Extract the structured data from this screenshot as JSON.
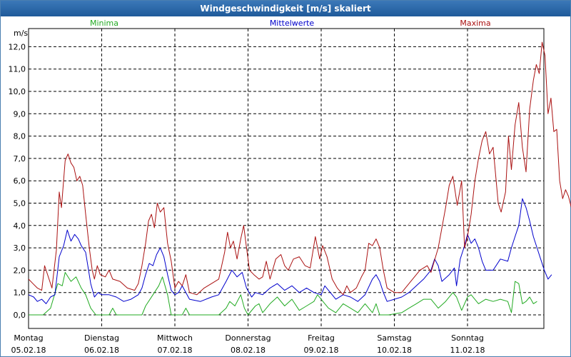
{
  "window": {
    "title": "Windgeschwindigkeit [m/s] skaliert"
  },
  "chart_data": {
    "type": "line",
    "title": "Windgeschwindigkeit [m/s] skaliert",
    "ylabel": "m/s",
    "ylim": [
      -0.8,
      12.6
    ],
    "yticks": [
      "0,0",
      "1,0",
      "2,0",
      "3,0",
      "4,0",
      "5,0",
      "6,0",
      "7,0",
      "8,0",
      "9,0",
      "10,0",
      "11,0",
      "12,0"
    ],
    "xlim": [
      0,
      7
    ],
    "days": [
      {
        "name": "Montag",
        "date": "05.02.18"
      },
      {
        "name": "Dienstag",
        "date": "06.02.18"
      },
      {
        "name": "Mittwoch",
        "date": "07.02.18"
      },
      {
        "name": "Donnerstag",
        "date": "08.02.18"
      },
      {
        "name": "Freitag",
        "date": "09.02.18"
      },
      {
        "name": "Samstag",
        "date": "10.02.18"
      },
      {
        "name": "Sonntag",
        "date": "11.02.18"
      }
    ],
    "grid": true,
    "legend_position": "top",
    "series": [
      {
        "name": "Minima",
        "color": "#22aa22",
        "points": [
          [
            0,
            0
          ],
          [
            0.2,
            0
          ],
          [
            0.3,
            0.3
          ],
          [
            0.4,
            1.4
          ],
          [
            0.46,
            1.3
          ],
          [
            0.5,
            1.9
          ],
          [
            0.58,
            1.5
          ],
          [
            0.65,
            1.7
          ],
          [
            0.72,
            1.2
          ],
          [
            0.78,
            0.9
          ],
          [
            0.85,
            0.3
          ],
          [
            0.92,
            0
          ],
          [
            1.1,
            0
          ],
          [
            1.15,
            0.3
          ],
          [
            1.2,
            0
          ],
          [
            1.55,
            0
          ],
          [
            1.6,
            0.4
          ],
          [
            1.7,
            0.9
          ],
          [
            1.78,
            1.3
          ],
          [
            1.83,
            1.7
          ],
          [
            1.9,
            0.9
          ],
          [
            1.95,
            0
          ],
          [
            2.1,
            0
          ],
          [
            2.15,
            0.3
          ],
          [
            2.2,
            0
          ],
          [
            2.6,
            0
          ],
          [
            2.7,
            0.3
          ],
          [
            2.75,
            0.6
          ],
          [
            2.82,
            0.4
          ],
          [
            2.9,
            0.9
          ],
          [
            2.95,
            0.3
          ],
          [
            3.0,
            0
          ],
          [
            3.1,
            0.4
          ],
          [
            3.15,
            0.5
          ],
          [
            3.2,
            0.1
          ],
          [
            3.3,
            0.5
          ],
          [
            3.4,
            0.8
          ],
          [
            3.5,
            0.4
          ],
          [
            3.6,
            0.7
          ],
          [
            3.7,
            0.2
          ],
          [
            3.8,
            0.4
          ],
          [
            3.9,
            0.6
          ],
          [
            3.95,
            0.9
          ],
          [
            4.05,
            0.5
          ],
          [
            4.1,
            0.3
          ],
          [
            4.2,
            0.1
          ],
          [
            4.3,
            0.5
          ],
          [
            4.4,
            0.3
          ],
          [
            4.5,
            0.1
          ],
          [
            4.6,
            0.5
          ],
          [
            4.7,
            0.1
          ],
          [
            4.75,
            0.5
          ],
          [
            4.8,
            0
          ],
          [
            4.92,
            0
          ],
          [
            5.1,
            0.1
          ],
          [
            5.2,
            0.3
          ],
          [
            5.3,
            0.5
          ],
          [
            5.4,
            0.7
          ],
          [
            5.5,
            0.7
          ],
          [
            5.6,
            0.3
          ],
          [
            5.7,
            0.6
          ],
          [
            5.8,
            1.0
          ],
          [
            5.85,
            0.8
          ],
          [
            5.92,
            0.2
          ],
          [
            6.0,
            0.8
          ],
          [
            6.05,
            0.9
          ],
          [
            6.15,
            0.5
          ],
          [
            6.25,
            0.7
          ],
          [
            6.35,
            0.6
          ],
          [
            6.45,
            0.7
          ],
          [
            6.55,
            0.6
          ],
          [
            6.6,
            0.1
          ],
          [
            6.65,
            1.5
          ],
          [
            6.7,
            1.4
          ],
          [
            6.75,
            0.5
          ],
          [
            6.8,
            0.6
          ],
          [
            6.85,
            0.8
          ],
          [
            6.9,
            0.5
          ],
          [
            6.95,
            0.6
          ]
        ]
      },
      {
        "name": "Mittelwerte",
        "color": "#0000cc",
        "points": [
          [
            0,
            0.9
          ],
          [
            0.07,
            0.8
          ],
          [
            0.12,
            0.6
          ],
          [
            0.18,
            0.7
          ],
          [
            0.24,
            0.5
          ],
          [
            0.3,
            0.8
          ],
          [
            0.36,
            0.9
          ],
          [
            0.42,
            2.6
          ],
          [
            0.48,
            3.1
          ],
          [
            0.53,
            3.8
          ],
          [
            0.58,
            3.3
          ],
          [
            0.63,
            3.6
          ],
          [
            0.68,
            3.4
          ],
          [
            0.72,
            3.1
          ],
          [
            0.78,
            2.8
          ],
          [
            0.85,
            1.4
          ],
          [
            0.9,
            0.8
          ],
          [
            0.95,
            1.0
          ],
          [
            1.0,
            0.9
          ],
          [
            1.1,
            0.9
          ],
          [
            1.2,
            0.8
          ],
          [
            1.3,
            0.6
          ],
          [
            1.4,
            0.7
          ],
          [
            1.5,
            0.9
          ],
          [
            1.55,
            1.2
          ],
          [
            1.6,
            1.8
          ],
          [
            1.65,
            2.3
          ],
          [
            1.7,
            2.2
          ],
          [
            1.75,
            2.7
          ],
          [
            1.8,
            3.0
          ],
          [
            1.85,
            2.6
          ],
          [
            1.9,
            1.8
          ],
          [
            1.95,
            1.1
          ],
          [
            2.0,
            0.9
          ],
          [
            2.05,
            1.0
          ],
          [
            2.1,
            1.3
          ],
          [
            2.2,
            0.7
          ],
          [
            2.35,
            0.6
          ],
          [
            2.5,
            0.8
          ],
          [
            2.6,
            0.9
          ],
          [
            2.7,
            1.5
          ],
          [
            2.78,
            2.0
          ],
          [
            2.85,
            1.7
          ],
          [
            2.92,
            1.9
          ],
          [
            2.98,
            1.2
          ],
          [
            3.05,
            0.8
          ],
          [
            3.1,
            1.0
          ],
          [
            3.2,
            0.9
          ],
          [
            3.3,
            1.2
          ],
          [
            3.4,
            1.4
          ],
          [
            3.5,
            1.1
          ],
          [
            3.6,
            1.3
          ],
          [
            3.7,
            1.0
          ],
          [
            3.8,
            1.2
          ],
          [
            3.9,
            1.0
          ],
          [
            4.0,
            0.9
          ],
          [
            4.05,
            1.3
          ],
          [
            4.1,
            1.1
          ],
          [
            4.2,
            0.7
          ],
          [
            4.3,
            0.9
          ],
          [
            4.4,
            0.8
          ],
          [
            4.5,
            0.6
          ],
          [
            4.6,
            0.9
          ],
          [
            4.7,
            1.6
          ],
          [
            4.75,
            1.8
          ],
          [
            4.8,
            1.5
          ],
          [
            4.85,
            1.0
          ],
          [
            4.9,
            0.6
          ],
          [
            5.0,
            0.7
          ],
          [
            5.1,
            0.8
          ],
          [
            5.2,
            1.0
          ],
          [
            5.3,
            1.3
          ],
          [
            5.4,
            1.6
          ],
          [
            5.5,
            2.0
          ],
          [
            5.55,
            2.5
          ],
          [
            5.6,
            2.2
          ],
          [
            5.65,
            1.5
          ],
          [
            5.75,
            1.8
          ],
          [
            5.82,
            2.1
          ],
          [
            5.85,
            1.3
          ],
          [
            5.9,
            2.5
          ],
          [
            5.95,
            3.0
          ],
          [
            6.0,
            3.6
          ],
          [
            6.05,
            3.2
          ],
          [
            6.1,
            3.4
          ],
          [
            6.15,
            3.0
          ],
          [
            6.2,
            2.4
          ],
          [
            6.25,
            2.0
          ],
          [
            6.35,
            2.0
          ],
          [
            6.45,
            2.5
          ],
          [
            6.55,
            2.4
          ],
          [
            6.6,
            3.0
          ],
          [
            6.65,
            3.5
          ],
          [
            6.7,
            4.0
          ],
          [
            6.75,
            5.2
          ],
          [
            6.8,
            4.8
          ],
          [
            6.85,
            4.2
          ],
          [
            6.9,
            3.5
          ],
          [
            6.95,
            3.0
          ],
          [
            7.0,
            2.5
          ],
          [
            7.05,
            2.0
          ],
          [
            7.1,
            1.6
          ],
          [
            7.15,
            1.8
          ]
        ]
      },
      {
        "name": "Maxima",
        "color": "#aa1111",
        "points": [
          [
            0,
            1.6
          ],
          [
            0.06,
            1.4
          ],
          [
            0.12,
            1.2
          ],
          [
            0.18,
            1.1
          ],
          [
            0.22,
            2.2
          ],
          [
            0.27,
            1.7
          ],
          [
            0.32,
            1.2
          ],
          [
            0.38,
            2.9
          ],
          [
            0.42,
            5.5
          ],
          [
            0.45,
            4.8
          ],
          [
            0.5,
            6.9
          ],
          [
            0.54,
            7.2
          ],
          [
            0.58,
            6.8
          ],
          [
            0.62,
            6.6
          ],
          [
            0.66,
            6.0
          ],
          [
            0.7,
            6.2
          ],
          [
            0.74,
            5.8
          ],
          [
            0.78,
            4.5
          ],
          [
            0.83,
            3.0
          ],
          [
            0.87,
            2.0
          ],
          [
            0.9,
            1.6
          ],
          [
            0.94,
            2.2
          ],
          [
            0.98,
            1.8
          ],
          [
            1.05,
            1.7
          ],
          [
            1.1,
            2.0
          ],
          [
            1.15,
            1.6
          ],
          [
            1.25,
            1.5
          ],
          [
            1.35,
            1.2
          ],
          [
            1.45,
            1.1
          ],
          [
            1.5,
            1.4
          ],
          [
            1.55,
            2.2
          ],
          [
            1.6,
            3.2
          ],
          [
            1.64,
            4.2
          ],
          [
            1.68,
            4.5
          ],
          [
            1.72,
            3.9
          ],
          [
            1.76,
            5.0
          ],
          [
            1.8,
            4.6
          ],
          [
            1.85,
            4.8
          ],
          [
            1.9,
            3.2
          ],
          [
            1.95,
            2.4
          ],
          [
            2.0,
            1.2
          ],
          [
            2.05,
            1.5
          ],
          [
            2.1,
            1.3
          ],
          [
            2.15,
            1.8
          ],
          [
            2.2,
            1.0
          ],
          [
            2.3,
            0.9
          ],
          [
            2.4,
            1.2
          ],
          [
            2.5,
            1.4
          ],
          [
            2.6,
            1.6
          ],
          [
            2.68,
            2.8
          ],
          [
            2.72,
            3.7
          ],
          [
            2.76,
            3.0
          ],
          [
            2.8,
            3.3
          ],
          [
            2.85,
            2.5
          ],
          [
            2.9,
            3.4
          ],
          [
            2.94,
            4.0
          ],
          [
            2.98,
            3.0
          ],
          [
            3.02,
            2.0
          ],
          [
            3.08,
            1.8
          ],
          [
            3.15,
            1.6
          ],
          [
            3.2,
            1.7
          ],
          [
            3.25,
            2.4
          ],
          [
            3.3,
            1.6
          ],
          [
            3.38,
            2.5
          ],
          [
            3.45,
            2.7
          ],
          [
            3.5,
            2.2
          ],
          [
            3.55,
            2.0
          ],
          [
            3.62,
            2.5
          ],
          [
            3.7,
            2.6
          ],
          [
            3.78,
            2.2
          ],
          [
            3.85,
            2.1
          ],
          [
            3.92,
            3.5
          ],
          [
            3.98,
            2.5
          ],
          [
            4.02,
            3.1
          ],
          [
            4.08,
            2.6
          ],
          [
            4.15,
            1.6
          ],
          [
            4.22,
            1.2
          ],
          [
            4.3,
            0.9
          ],
          [
            4.35,
            1.3
          ],
          [
            4.4,
            1.0
          ],
          [
            4.48,
            1.2
          ],
          [
            4.55,
            1.7
          ],
          [
            4.6,
            2.0
          ],
          [
            4.65,
            3.2
          ],
          [
            4.7,
            3.1
          ],
          [
            4.75,
            3.4
          ],
          [
            4.8,
            3.0
          ],
          [
            4.85,
            2.0
          ],
          [
            4.9,
            1.2
          ],
          [
            5.0,
            1.0
          ],
          [
            5.1,
            1.0
          ],
          [
            5.15,
            1.2
          ],
          [
            5.25,
            1.6
          ],
          [
            5.35,
            2.0
          ],
          [
            5.45,
            2.2
          ],
          [
            5.5,
            1.9
          ],
          [
            5.6,
            3.0
          ],
          [
            5.7,
            4.8
          ],
          [
            5.75,
            5.8
          ],
          [
            5.8,
            6.2
          ],
          [
            5.86,
            4.9
          ],
          [
            5.92,
            6.0
          ],
          [
            5.96,
            3.0
          ],
          [
            6.0,
            3.5
          ],
          [
            6.05,
            4.5
          ],
          [
            6.1,
            6.0
          ],
          [
            6.15,
            7.0
          ],
          [
            6.2,
            7.8
          ],
          [
            6.25,
            8.2
          ],
          [
            6.3,
            7.2
          ],
          [
            6.35,
            7.5
          ],
          [
            6.42,
            5.0
          ],
          [
            6.46,
            4.6
          ],
          [
            6.52,
            5.5
          ],
          [
            6.56,
            8.0
          ],
          [
            6.6,
            6.5
          ],
          [
            6.65,
            8.5
          ],
          [
            6.7,
            9.5
          ],
          [
            6.75,
            7.5
          ],
          [
            6.8,
            6.4
          ],
          [
            6.85,
            9.2
          ],
          [
            6.9,
            10.5
          ],
          [
            6.94,
            11.2
          ],
          [
            6.98,
            10.8
          ],
          [
            7.02,
            12.2
          ],
          [
            7.06,
            11.6
          ],
          [
            7.1,
            9.0
          ],
          [
            7.14,
            9.7
          ],
          [
            7.18,
            8.2
          ],
          [
            7.22,
            8.3
          ],
          [
            7.26,
            6.0
          ],
          [
            7.3,
            5.2
          ],
          [
            7.34,
            5.6
          ],
          [
            7.38,
            5.3
          ],
          [
            7.42,
            4.8
          ]
        ]
      }
    ]
  }
}
